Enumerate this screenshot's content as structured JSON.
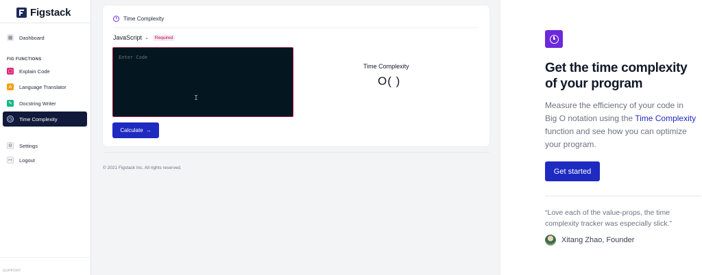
{
  "app": {
    "name": "Figstack"
  },
  "sidebar": {
    "dashboard": "Dashboard",
    "section_label": "FIG FUNCTIONS",
    "functions": [
      {
        "label": "Explain Code",
        "icon": "explain-code-icon",
        "color": "#db2777"
      },
      {
        "label": "Language Translator",
        "icon": "translate-icon",
        "color": "#f59e0b"
      },
      {
        "label": "Docstring Writer",
        "icon": "pencil-icon",
        "color": "#10b981"
      },
      {
        "label": "Time Complexity",
        "icon": "clock-icon",
        "active": true
      }
    ],
    "settings": "Settings",
    "logout": "Logout",
    "support_label": "SUPPORT"
  },
  "tool": {
    "title": "Time Complexity",
    "language": "JavaScript",
    "required_badge": "Required",
    "code_placeholder": "Enter Code",
    "calculate_label": "Calculate",
    "result_label": "Time Complexity",
    "result_value": "O( )"
  },
  "footer": {
    "copyright": "© 2021 Figstack Inc. All rights reserved."
  },
  "promo": {
    "headline": "Get the time complexity of your program",
    "desc_before": "Measure the efficiency of your code in Big O notation using the ",
    "desc_highlight": "Time Complexity",
    "desc_after": " function and see how you can optimize your program.",
    "cta_label": "Get started",
    "quote": "“Love each of the value-props, the time complexity tracker was especially slick.”",
    "author": "Xitang Zhao, Founder"
  },
  "colors": {
    "accent": "#1e2ac0",
    "brand": "#6d28d9",
    "active_nav": "#111a3a",
    "required_text": "#9d174d"
  }
}
